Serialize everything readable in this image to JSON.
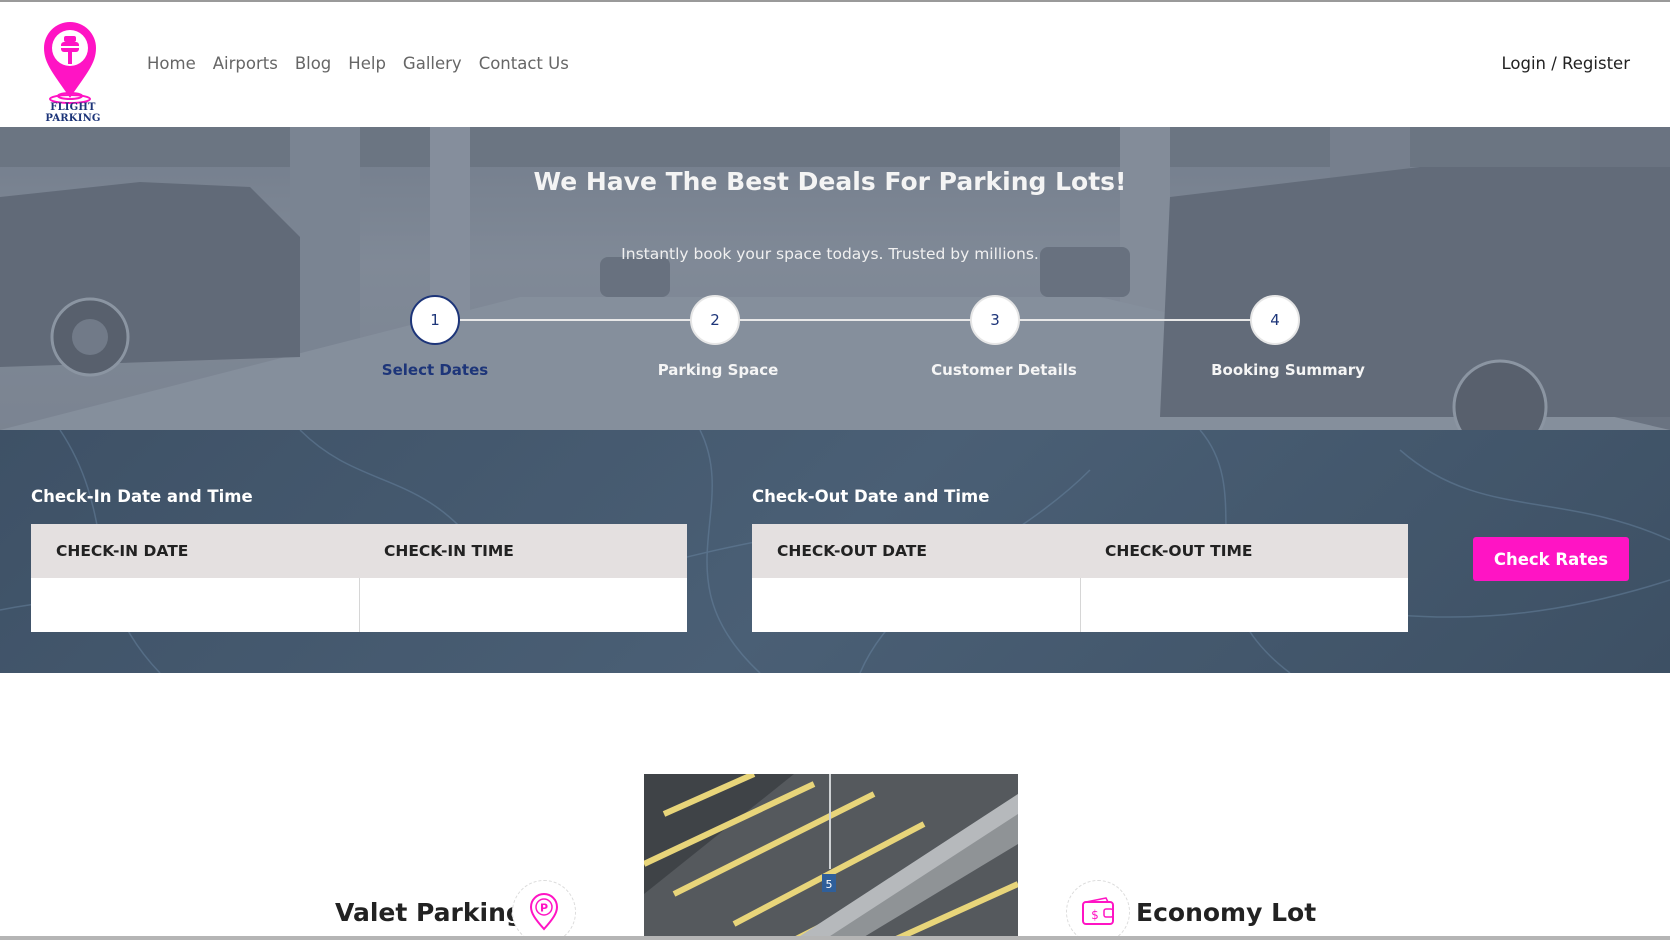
{
  "brand": {
    "logo_text": "FLIGHT PARKING",
    "accent": "#ff14c4",
    "navy": "#1d3579"
  },
  "nav": {
    "items": [
      {
        "label": "Home"
      },
      {
        "label": "Airports"
      },
      {
        "label": "Blog"
      },
      {
        "label": "Help"
      },
      {
        "label": "Gallery"
      },
      {
        "label": "Contact Us"
      }
    ],
    "login_label": "Login / Register"
  },
  "hero": {
    "title": "We Have The Best Deals For Parking Lots!",
    "subtitle": "Instantly book your space todays. Trusted by millions."
  },
  "steps": [
    {
      "number": "1",
      "label": "Select Dates",
      "active": true
    },
    {
      "number": "2",
      "label": "Parking Space",
      "active": false
    },
    {
      "number": "3",
      "label": "Customer Details",
      "active": false
    },
    {
      "number": "4",
      "label": "Booking Summary",
      "active": false
    }
  ],
  "booking": {
    "checkin": {
      "title": "Check-In Date and Time",
      "date_label": "CHECK-IN DATE",
      "time_label": "CHECK-IN TIME",
      "date_value": "",
      "time_value": ""
    },
    "checkout": {
      "title": "Check-Out Date and Time",
      "date_label": "CHECK-OUT DATE",
      "time_label": "CHECK-OUT TIME",
      "date_value": "",
      "time_value": ""
    },
    "button_label": "Check Rates"
  },
  "services": {
    "valet": {
      "title": "Valet Parking",
      "icon": "parking-pin-icon"
    },
    "economy": {
      "title": "Economy Lot",
      "icon": "wallet-icon"
    },
    "image_text": "5"
  }
}
